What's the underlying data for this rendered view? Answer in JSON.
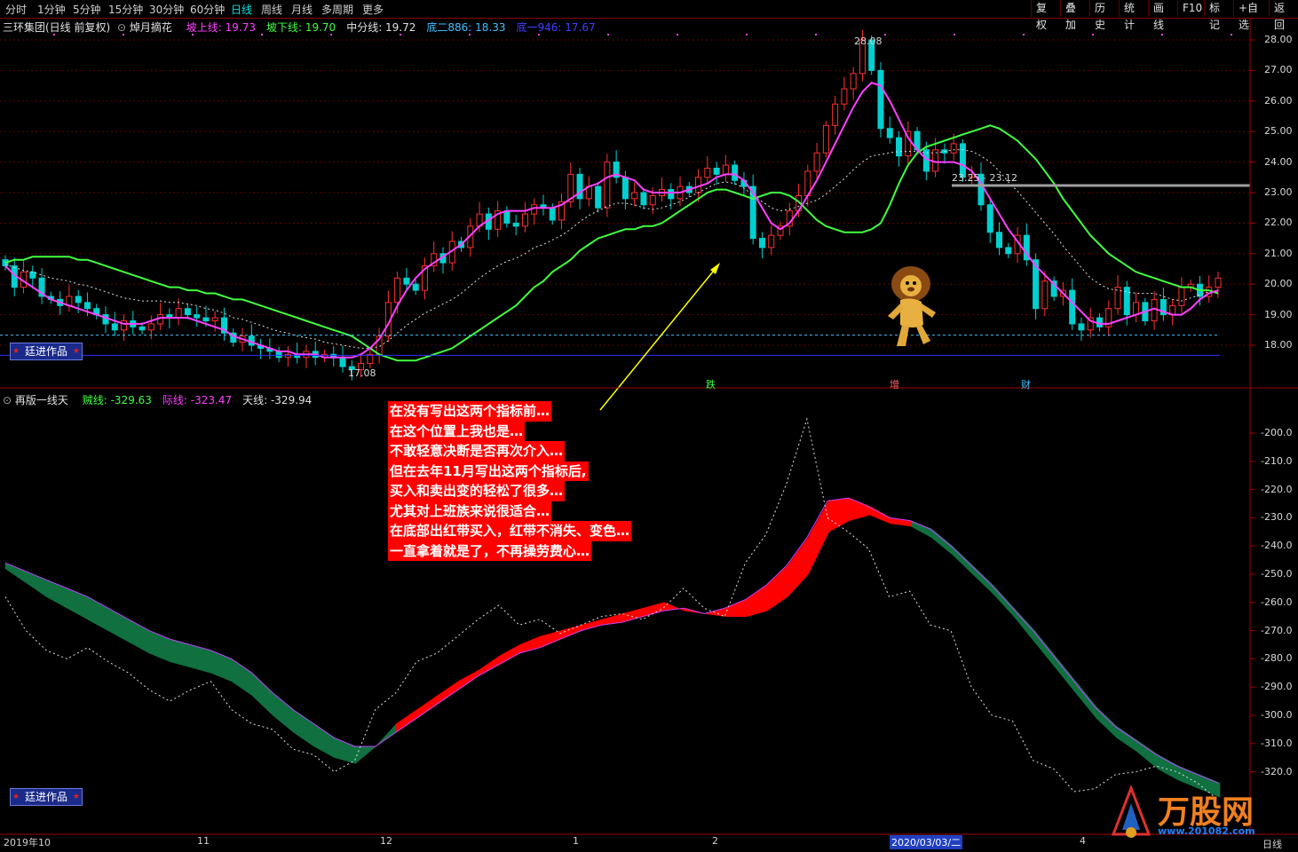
{
  "toolbar": {
    "periods": [
      "分时",
      "1分钟",
      "5分钟",
      "15分钟",
      "30分钟",
      "60分钟",
      "日线",
      "周线",
      "月线",
      "多周期",
      "更多"
    ],
    "active_period": "日线",
    "right_buttons": [
      "复权",
      "叠加",
      "历史",
      "统计",
      "画线",
      "F10",
      "标记",
      "+自选",
      "返回"
    ]
  },
  "main_panel": {
    "stock": "三环集团(日线 前复权)",
    "indicator": "焯月摘花",
    "items": [
      {
        "label": "坡上线: 19.73",
        "color": "#ff40ff"
      },
      {
        "label": "坡下线: 19.70",
        "color": "#40ff40"
      },
      {
        "label": "中分线: 19.72",
        "color": "#e0e0e0"
      },
      {
        "label": "底二886: 18.33",
        "color": "#40c0ff"
      },
      {
        "label": "底一946: 17.67",
        "color": "#4040ff"
      }
    ],
    "annotations": {
      "high": "28.08",
      "low": "17.08",
      "range": "23.25 - 23.12"
    },
    "markers": [
      "跌",
      "增",
      "财"
    ],
    "badge": "廷进作品"
  },
  "sub_panel": {
    "indicator": "再版一线天",
    "items": [
      {
        "label": "贼线: -329.63",
        "color": "#40ff40"
      },
      {
        "label": "际线: -323.47",
        "color": "#ff40ff"
      },
      {
        "label": "天线: -329.94",
        "color": "#e0e0e0"
      }
    ],
    "badge": "廷进作品"
  },
  "note_lines": [
    "在没有写出这两个指标前…",
    "在这个位置上我也是…",
    "不敢轻意决断是否再次介入…",
    "但在去年11月写出这两个指标后,",
    "买入和卖出变的轻松了很多…",
    "尤其对上班族来说很适合…",
    "在底部出红带买入，红带不消失、变色…",
    "一直拿着就是了，不再操劳费心…"
  ],
  "x_axis": {
    "labels": [
      "2019年10",
      "11",
      "12",
      "1",
      "2",
      "2020/03/03/二",
      "4"
    ],
    "right_label": "日线"
  },
  "watermark": {
    "text": "万股网",
    "url": "www.201082.com"
  },
  "chart_data": [
    {
      "type": "candlestick",
      "title": "三环集团(日线 前复权)",
      "ylim": [
        17.5,
        28.3
      ],
      "yticks": [
        18,
        19,
        20,
        21,
        22,
        23,
        24,
        25,
        26,
        27,
        28
      ],
      "y_tick_labels": [
        "18.00",
        "19.00",
        "20.00",
        "21.00",
        "22.00",
        "23.00",
        "24.00",
        "25.00",
        "26.00",
        "27.00",
        "28.00"
      ],
      "close": [
        20.6,
        19.9,
        20.4,
        20.2,
        19.6,
        19.5,
        19.3,
        19.6,
        19.4,
        19.2,
        19.0,
        18.7,
        18.5,
        18.8,
        18.6,
        18.5,
        18.7,
        19.0,
        18.9,
        19.2,
        19.0,
        18.9,
        18.8,
        18.9,
        18.4,
        18.1,
        18.3,
        18.0,
        17.9,
        17.8,
        17.6,
        17.7,
        17.6,
        17.8,
        17.6,
        17.7,
        17.6,
        17.3,
        17.2,
        17.4,
        17.7,
        18.3,
        19.4,
        20.2,
        20.0,
        19.8,
        20.6,
        21.0,
        20.7,
        21.4,
        21.2,
        21.9,
        22.3,
        21.8,
        22.4,
        22.0,
        21.9,
        22.3,
        22.6,
        22.5,
        22.1,
        22.7,
        23.6,
        22.8,
        23.2,
        22.5,
        24.0,
        23.5,
        22.8,
        23.0,
        22.6,
        22.9,
        23.1,
        22.8,
        23.2,
        23.0,
        23.5,
        23.8,
        23.6,
        23.9,
        23.4,
        23.2,
        21.5,
        21.2,
        21.6,
        21.9,
        22.4,
        22.9,
        23.7,
        24.3,
        25.2,
        25.9,
        26.4,
        26.9,
        28.0,
        27.0,
        25.1,
        24.8,
        24.2,
        25.0,
        24.4,
        23.7,
        24.4,
        24.3,
        24.6,
        23.5,
        23.6,
        22.6,
        21.7,
        21.2,
        21.0,
        21.6,
        20.8,
        19.2,
        20.1,
        19.6,
        19.8,
        18.7,
        18.5,
        18.9,
        18.6,
        19.2,
        19.9,
        19.0,
        19.4,
        18.8,
        19.5,
        19.0,
        19.3,
        19.9,
        20.0,
        19.6,
        19.9,
        20.2
      ],
      "series": [
        {
          "name": "坡上线",
          "values": [
            20.6,
            20.3,
            20.1,
            19.9,
            19.7,
            19.5,
            19.4,
            19.3,
            19.2,
            19.1,
            19.0,
            18.9,
            18.8,
            18.7,
            18.7,
            18.7,
            18.8,
            18.9,
            18.9,
            18.9,
            18.9,
            18.8,
            18.7,
            18.6,
            18.5,
            18.3,
            18.2,
            18.1,
            18.0,
            17.9,
            17.8,
            17.8,
            17.7,
            17.7,
            17.7,
            17.6,
            17.6,
            17.6,
            17.6,
            17.7,
            17.9,
            18.2,
            18.7,
            19.3,
            19.8,
            20.2,
            20.5,
            20.7,
            20.9,
            21.1,
            21.3,
            21.6,
            21.9,
            22.1,
            22.3,
            22.4,
            22.4,
            22.4,
            22.5,
            22.5,
            22.5,
            22.6,
            22.8,
            23.0,
            23.2,
            23.3,
            23.5,
            23.6,
            23.5,
            23.4,
            23.1,
            23.0,
            23.0,
            23.0,
            23.0,
            23.1,
            23.2,
            23.3,
            23.5,
            23.6,
            23.6,
            23.4,
            23.0,
            22.5,
            22.0,
            21.8,
            22.0,
            22.4,
            22.9,
            23.4,
            24.0,
            24.6,
            25.2,
            25.8,
            26.3,
            26.6,
            26.5,
            26.0,
            25.4,
            24.8,
            24.4,
            24.1,
            24.0,
            24.0,
            24.0,
            23.9,
            23.7,
            23.3,
            22.8,
            22.3,
            21.8,
            21.4,
            21.0,
            20.6,
            20.3,
            20.0,
            19.7,
            19.4,
            19.1,
            18.8,
            18.7,
            18.7,
            18.8,
            18.9,
            19.0,
            19.1,
            19.2,
            19.1,
            19.0,
            19.0,
            19.2,
            19.5,
            19.7,
            19.8
          ]
        },
        {
          "name": "坡下线",
          "values": [
            20.7,
            20.8,
            20.8,
            20.9,
            20.9,
            20.9,
            20.9,
            20.9,
            20.8,
            20.8,
            20.7,
            20.6,
            20.5,
            20.4,
            20.3,
            20.2,
            20.1,
            20.0,
            19.9,
            19.9,
            19.8,
            19.8,
            19.7,
            19.7,
            19.6,
            19.5,
            19.5,
            19.4,
            19.3,
            19.2,
            19.1,
            19.0,
            18.9,
            18.8,
            18.7,
            18.6,
            18.5,
            18.4,
            18.3,
            18.1,
            17.9,
            17.7,
            17.6,
            17.5,
            17.5,
            17.5,
            17.6,
            17.7,
            17.8,
            17.9,
            18.1,
            18.3,
            18.5,
            18.7,
            18.9,
            19.1,
            19.3,
            19.6,
            19.9,
            20.1,
            20.4,
            20.6,
            20.8,
            21.1,
            21.3,
            21.5,
            21.6,
            21.7,
            21.8,
            21.8,
            21.9,
            21.9,
            22.0,
            22.2,
            22.4,
            22.6,
            22.8,
            23.0,
            23.1,
            23.1,
            23.0,
            22.9,
            22.8,
            22.9,
            23.0,
            23.0,
            22.9,
            22.7,
            22.4,
            22.1,
            21.9,
            21.8,
            21.7,
            21.7,
            21.7,
            21.8,
            22.0,
            22.6,
            23.3,
            23.9,
            24.3,
            24.5,
            24.6,
            24.7,
            24.8,
            24.9,
            25.0,
            25.1,
            25.2,
            25.1,
            24.9,
            24.7,
            24.4,
            24.1,
            23.7,
            23.3,
            22.8,
            22.4,
            22.0,
            21.6,
            21.3,
            21.0,
            20.8,
            20.6,
            20.4,
            20.3,
            20.2,
            20.1,
            20.0,
            19.9,
            19.9,
            19.8,
            19.8,
            19.7
          ]
        }
      ],
      "levels": [
        {
          "name": "底二886",
          "value": 18.33
        },
        {
          "name": "底一946",
          "value": 17.67
        }
      ]
    },
    {
      "type": "area",
      "title": "再版一线天",
      "ylim": [
        -327,
        -186
      ],
      "yticks": [
        -200,
        -210,
        -220,
        -230,
        -240,
        -250,
        -260,
        -270,
        -280,
        -290,
        -300,
        -310,
        -320
      ],
      "y_tick_labels": [
        "-200.0",
        "-210.0",
        "-220.0",
        "-230.0",
        "-240.0",
        "-250.0",
        "-260.0",
        "-270.0",
        "-280.0",
        "-290.0",
        "-300.0",
        "-310.0",
        "-320.0"
      ],
      "series": [
        {
          "name": "际线",
          "values": [
            -246,
            -249,
            -252,
            -255,
            -258,
            -262,
            -266,
            -270,
            -273,
            -275,
            -277,
            -280,
            -285,
            -292,
            -298,
            -303,
            -308,
            -311,
            -311,
            -306,
            -301,
            -296,
            -291,
            -286,
            -282,
            -278,
            -276,
            -273,
            -270,
            -268,
            -267,
            -265,
            -263,
            -262,
            -264,
            -262,
            -259,
            -254,
            -247,
            -237,
            -224,
            -223,
            -226,
            -230,
            -231,
            -234,
            -240,
            -247,
            -254,
            -262,
            -270,
            -279,
            -288,
            -297,
            -304,
            -309,
            -314,
            -318,
            -321,
            -324
          ]
        },
        {
          "name": "贼线",
          "values": [
            -248,
            -253,
            -258,
            -262,
            -266,
            -270,
            -274,
            -278,
            -281,
            -283,
            -285,
            -288,
            -293,
            -300,
            -306,
            -311,
            -315,
            -317,
            -311,
            -303,
            -298,
            -293,
            -288,
            -284,
            -279,
            -275,
            -272,
            -270,
            -268,
            -266,
            -264,
            -262,
            -260,
            -263,
            -264,
            -265,
            -265,
            -263,
            -258,
            -250,
            -235,
            -231,
            -229,
            -232,
            -233,
            -237,
            -243,
            -250,
            -257,
            -265,
            -274,
            -283,
            -292,
            -301,
            -308,
            -313,
            -319,
            -323,
            -326,
            -329
          ]
        },
        {
          "name": "天线",
          "values": [
            -258,
            -270,
            -277,
            -280,
            -276,
            -281,
            -285,
            -291,
            -295,
            -291,
            -288,
            -298,
            -303,
            -305,
            -312,
            -314,
            -320,
            -316,
            -298,
            -292,
            -281,
            -278,
            -272,
            -266,
            -261,
            -268,
            -266,
            -271,
            -268,
            -265,
            -264,
            -266,
            -262,
            -255,
            -262,
            -265,
            -246,
            -236,
            -218,
            -195,
            -230,
            -235,
            -241,
            -258,
            -256,
            -268,
            -270,
            -290,
            -300,
            -302,
            -316,
            -319,
            -327,
            -326,
            -321,
            -320,
            -318,
            -320,
            -324,
            -330
          ]
        }
      ]
    }
  ]
}
